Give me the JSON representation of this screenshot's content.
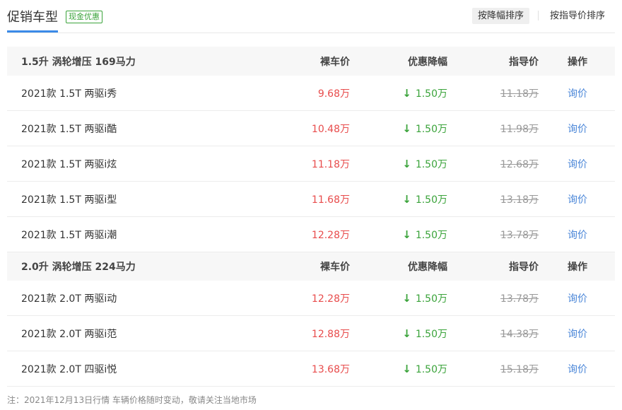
{
  "header": {
    "title": "促销车型",
    "badge": "现金优惠",
    "sort_by_discount": "按降幅排序",
    "sort_by_guide": "按指导价排序"
  },
  "groups": [
    {
      "name": "1.5升 涡轮增压 169马力",
      "col_price": "裸车价",
      "col_discount": "优惠降幅",
      "col_guide": "指导价",
      "col_op": "操作",
      "rows": [
        {
          "name": "2021款 1.5T 两驱i秀",
          "price": "9.68万",
          "discount": "1.50万",
          "guide": "11.18万",
          "op": "询价"
        },
        {
          "name": "2021款 1.5T 两驱i酷",
          "price": "10.48万",
          "discount": "1.50万",
          "guide": "11.98万",
          "op": "询价"
        },
        {
          "name": "2021款 1.5T 两驱i炫",
          "price": "11.18万",
          "discount": "1.50万",
          "guide": "12.68万",
          "op": "询价"
        },
        {
          "name": "2021款 1.5T 两驱i型",
          "price": "11.68万",
          "discount": "1.50万",
          "guide": "13.18万",
          "op": "询价"
        },
        {
          "name": "2021款 1.5T 两驱i潮",
          "price": "12.28万",
          "discount": "1.50万",
          "guide": "13.78万",
          "op": "询价"
        }
      ]
    },
    {
      "name": "2.0升 涡轮增压 224马力",
      "col_price": "裸车价",
      "col_discount": "优惠降幅",
      "col_guide": "指导价",
      "col_op": "操作",
      "rows": [
        {
          "name": "2021款 2.0T 两驱i动",
          "price": "12.28万",
          "discount": "1.50万",
          "guide": "13.78万",
          "op": "询价"
        },
        {
          "name": "2021款 2.0T 两驱i范",
          "price": "12.88万",
          "discount": "1.50万",
          "guide": "14.38万",
          "op": "询价"
        },
        {
          "name": "2021款 2.0T 四驱i悦",
          "price": "13.68万",
          "discount": "1.50万",
          "guide": "15.18万",
          "op": "询价"
        }
      ]
    }
  ],
  "note": "注：2021年12月13日行情 车辆价格随时变动，敬请关注当地市场",
  "icons": {
    "discount_arrow": "down-arrow-icon"
  },
  "colors": {
    "price": "#e84c4c",
    "discount": "#3aa33a",
    "link": "#4a86d8",
    "accent": "#3b8ae8"
  }
}
